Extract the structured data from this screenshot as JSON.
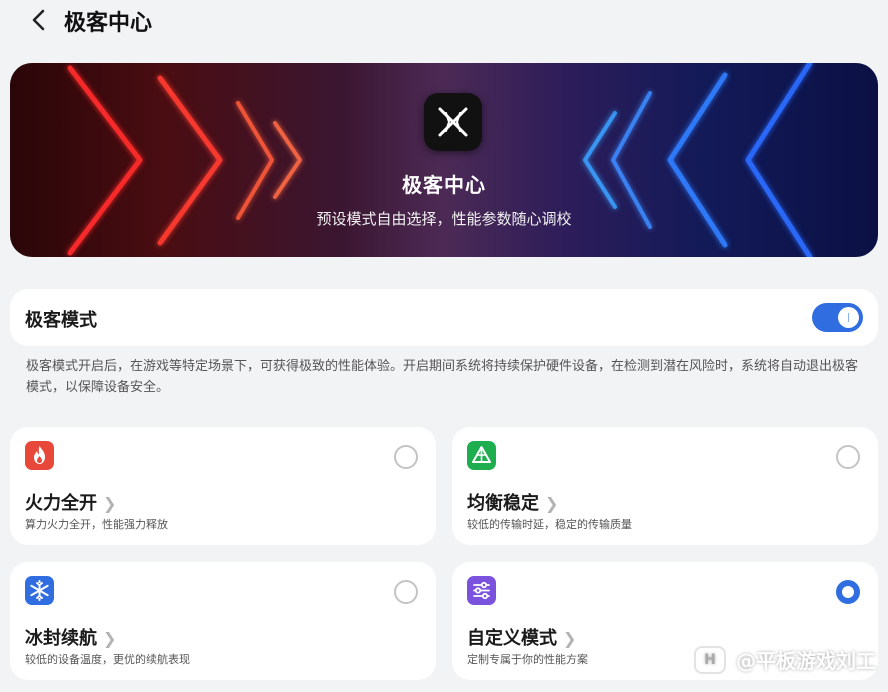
{
  "header": {
    "title": "极客中心"
  },
  "banner": {
    "title": "极客中心",
    "subtitle": "预设模式自由选择，性能参数随心调校"
  },
  "toggle": {
    "label": "极客模式",
    "on": true
  },
  "description": "极客模式开启后，在游戏等特定场景下，可获得极致的性能体验。开启期间系统将持续保护硬件设备，在检测到潜在风险时，系统将自动退出极客模式，以保障设备安全。",
  "modes": [
    {
      "name": "火力全开",
      "desc": "算力火力全开，性能强力释放",
      "icon": "flame-icon",
      "color": "#e8483a",
      "selected": false
    },
    {
      "name": "均衡稳定",
      "desc": "较低的传输时延，稳定的传输质量",
      "icon": "balance-triangle-icon",
      "color": "#1fae4f",
      "selected": false
    },
    {
      "name": "冰封续航",
      "desc": "较低的设备温度，更优的续航表现",
      "icon": "snowflake-icon",
      "color": "#2f6de1",
      "selected": false
    },
    {
      "name": "自定义模式",
      "desc": "定制专属于你的性能方案",
      "icon": "sliders-icon",
      "color": "#7a52dd",
      "selected": true
    }
  ],
  "watermark": {
    "text": "@平板游戏刘工",
    "logo": "H"
  },
  "colors": {
    "accent": "#2f6de1"
  }
}
